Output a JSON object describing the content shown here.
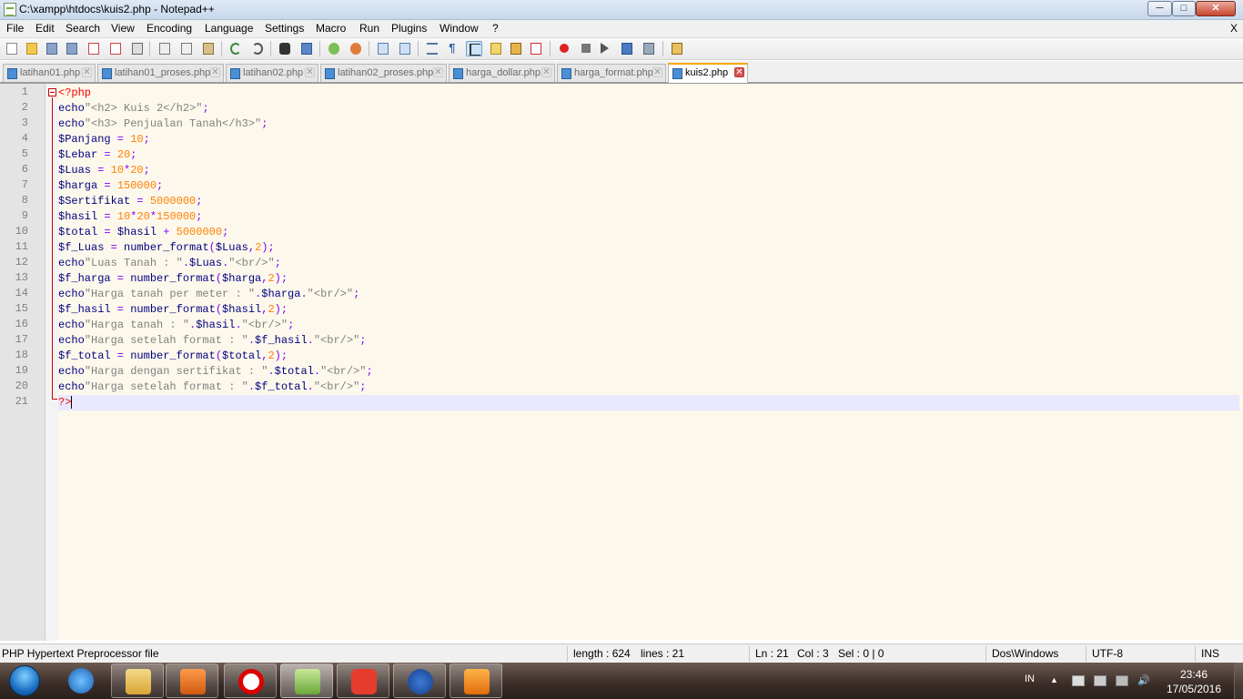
{
  "window": {
    "title": "C:\\xampp\\htdocs\\kuis2.php - Notepad++",
    "min_label": "0",
    "max_label": "1",
    "close_label": "x"
  },
  "menu": {
    "items": [
      "File",
      "Edit",
      "Search",
      "View",
      "Encoding",
      "Language",
      "Settings",
      "Macro",
      "Run",
      "Plugins",
      "Window",
      "?"
    ],
    "close": "X"
  },
  "tabs": [
    {
      "label": "latihan01.php",
      "active": false
    },
    {
      "label": "latihan01_proses.php",
      "active": false
    },
    {
      "label": "latihan02.php",
      "active": false
    },
    {
      "label": "latihan02_proses.php",
      "active": false
    },
    {
      "label": "harga_dollar.php",
      "active": false
    },
    {
      "label": "harga_format.php",
      "active": false
    },
    {
      "label": "kuis2.php",
      "active": true
    }
  ],
  "editor": {
    "line_numbers": [
      "1",
      "2",
      "3",
      "4",
      "5",
      "6",
      "7",
      "8",
      "9",
      "10",
      "11",
      "12",
      "13",
      "14",
      "15",
      "16",
      "17",
      "18",
      "19",
      "20",
      "21"
    ],
    "current_line": 21,
    "lines": [
      [
        [
          "tag",
          "<?php"
        ]
      ],
      [
        [
          "kw",
          "echo"
        ],
        [
          "str",
          "\"<h2> Kuis 2</h2>\""
        ],
        [
          "op",
          ";"
        ]
      ],
      [
        [
          "kw",
          "echo"
        ],
        [
          "str",
          "\"<h3> Penjualan Tanah</h3>\""
        ],
        [
          "op",
          ";"
        ]
      ],
      [
        [
          "var",
          "$Panjang"
        ],
        [
          "op",
          " = "
        ],
        [
          "num",
          "10"
        ],
        [
          "op",
          ";"
        ]
      ],
      [
        [
          "var",
          "$Lebar"
        ],
        [
          "op",
          " = "
        ],
        [
          "num",
          "20"
        ],
        [
          "op",
          ";"
        ]
      ],
      [
        [
          "var",
          "$Luas"
        ],
        [
          "op",
          " = "
        ],
        [
          "num",
          "10"
        ],
        [
          "op",
          "*"
        ],
        [
          "num",
          "20"
        ],
        [
          "op",
          ";"
        ]
      ],
      [
        [
          "var",
          "$harga"
        ],
        [
          "op",
          " = "
        ],
        [
          "num",
          "150000"
        ],
        [
          "op",
          ";"
        ]
      ],
      [
        [
          "var",
          "$Sertifikat"
        ],
        [
          "op",
          " = "
        ],
        [
          "num",
          "5000000"
        ],
        [
          "op",
          ";"
        ]
      ],
      [
        [
          "var",
          "$hasil"
        ],
        [
          "op",
          " = "
        ],
        [
          "num",
          "10"
        ],
        [
          "op",
          "*"
        ],
        [
          "num",
          "20"
        ],
        [
          "op",
          "*"
        ],
        [
          "num",
          "150000"
        ],
        [
          "op",
          ";"
        ]
      ],
      [
        [
          "var",
          "$total"
        ],
        [
          "op",
          " = "
        ],
        [
          "var",
          "$hasil"
        ],
        [
          "op",
          " + "
        ],
        [
          "num",
          "5000000"
        ],
        [
          "op",
          ";"
        ]
      ],
      [
        [
          "var",
          "$f_Luas"
        ],
        [
          "op",
          " = "
        ],
        [
          "kw",
          "number_format"
        ],
        [
          "op",
          "("
        ],
        [
          "var",
          "$Luas"
        ],
        [
          "op",
          ","
        ],
        [
          "num",
          "2"
        ],
        [
          "op",
          ");"
        ]
      ],
      [
        [
          "kw",
          "echo"
        ],
        [
          "str",
          "\"Luas Tanah : \""
        ],
        [
          "op",
          "."
        ],
        [
          "var",
          "$Luas"
        ],
        [
          "op",
          "."
        ],
        [
          "str",
          "\"<br/>\""
        ],
        [
          "op",
          ";"
        ]
      ],
      [
        [
          "var",
          "$f_harga"
        ],
        [
          "op",
          " = "
        ],
        [
          "kw",
          "number_format"
        ],
        [
          "op",
          "("
        ],
        [
          "var",
          "$harga"
        ],
        [
          "op",
          ","
        ],
        [
          "num",
          "2"
        ],
        [
          "op",
          ");"
        ]
      ],
      [
        [
          "kw",
          "echo"
        ],
        [
          "str",
          "\"Harga tanah per meter : \""
        ],
        [
          "op",
          "."
        ],
        [
          "var",
          "$harga"
        ],
        [
          "op",
          "."
        ],
        [
          "str",
          "\"<br/>\""
        ],
        [
          "op",
          ";"
        ]
      ],
      [
        [
          "var",
          "$f_hasil"
        ],
        [
          "op",
          " = "
        ],
        [
          "kw",
          "number_format"
        ],
        [
          "op",
          "("
        ],
        [
          "var",
          "$hasil"
        ],
        [
          "op",
          ","
        ],
        [
          "num",
          "2"
        ],
        [
          "op",
          ");"
        ]
      ],
      [
        [
          "kw",
          "echo"
        ],
        [
          "str",
          "\"Harga tanah : \""
        ],
        [
          "op",
          "."
        ],
        [
          "var",
          "$hasil"
        ],
        [
          "op",
          "."
        ],
        [
          "str",
          "\"<br/>\""
        ],
        [
          "op",
          ";"
        ]
      ],
      [
        [
          "kw",
          "echo"
        ],
        [
          "str",
          "\"Harga setelah format : \""
        ],
        [
          "op",
          "."
        ],
        [
          "var",
          "$f_hasil"
        ],
        [
          "op",
          "."
        ],
        [
          "str",
          "\"<br/>\""
        ],
        [
          "op",
          ";"
        ]
      ],
      [
        [
          "var",
          "$f_total"
        ],
        [
          "op",
          " = "
        ],
        [
          "kw",
          "number_format"
        ],
        [
          "op",
          "("
        ],
        [
          "var",
          "$total"
        ],
        [
          "op",
          ","
        ],
        [
          "num",
          "2"
        ],
        [
          "op",
          ");"
        ]
      ],
      [
        [
          "kw",
          "echo"
        ],
        [
          "str",
          "\"Harga dengan sertifikat : \""
        ],
        [
          "op",
          "."
        ],
        [
          "var",
          "$total"
        ],
        [
          "op",
          "."
        ],
        [
          "str",
          "\"<br/>\""
        ],
        [
          "op",
          ";"
        ]
      ],
      [
        [
          "kw",
          "echo"
        ],
        [
          "str",
          "\"Harga setelah format : \""
        ],
        [
          "op",
          "."
        ],
        [
          "var",
          "$f_total"
        ],
        [
          "op",
          "."
        ],
        [
          "str",
          "\"<br/>\""
        ],
        [
          "op",
          ";"
        ]
      ],
      [
        [
          "tag",
          "?>"
        ]
      ]
    ]
  },
  "status": {
    "file_type": "PHP Hypertext Preprocessor file",
    "length": "length : 624",
    "lines": "lines : 21",
    "ln": "Ln : 21",
    "col": "Col : 3",
    "sel": "Sel : 0 | 0",
    "eol": "Dos\\Windows",
    "encoding": "UTF-8",
    "mode": "INS"
  },
  "taskbar": {
    "apps": [
      "windows-explorer",
      "windows-media-player",
      "opera",
      "notepad-plus-plus",
      "foxit",
      "3g-modem",
      "pdf-creator"
    ],
    "language": "IN",
    "time": "23:46",
    "date": "17/05/2016"
  },
  "colors": {
    "editor_bg": "#fdf8ec",
    "current_line": "#e8e8ff",
    "keyword": "#000080",
    "string": "#808080",
    "number": "#ff8000",
    "tag": "#ff0000"
  }
}
